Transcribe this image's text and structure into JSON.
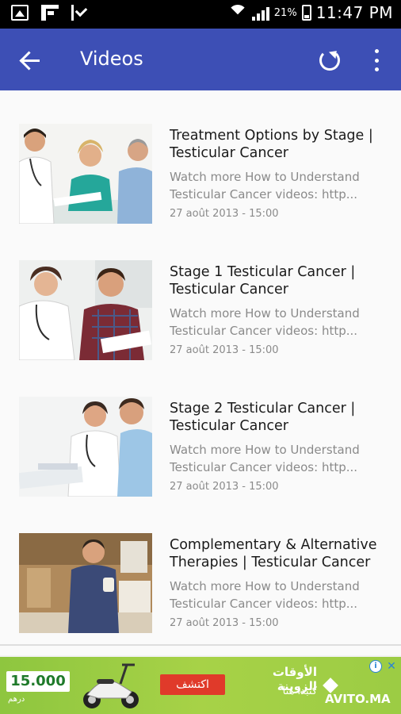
{
  "status_bar": {
    "battery_percent": "21%",
    "time": "11:47 PM",
    "left_icons": [
      "gallery-icon",
      "flipboard-icon",
      "check-icon"
    ],
    "right_icons": [
      "wifi-icon",
      "signal-icon",
      "battery-icon"
    ]
  },
  "app_bar": {
    "title": "Videos",
    "color": "#3d4fb5",
    "icons": [
      "arrow-back-icon",
      "refresh-icon",
      "more-vert-icon"
    ]
  },
  "videos": [
    {
      "title": "Treatment Options by Stage | Testicular Cancer",
      "desc_line1": "Watch more How to Understand",
      "desc_line2": "Testicular Cancer videos: http...",
      "date": "27 août 2013 - 15:00"
    },
    {
      "title": "Stage 1 Testicular Cancer | Testicular Cancer",
      "desc_line1": "Watch more How to Understand",
      "desc_line2": "Testicular Cancer videos: http...",
      "date": "27 août 2013 - 15:00"
    },
    {
      "title": "Stage 2 Testicular Cancer | Testicular Cancer",
      "desc_line1": "Watch more How to Understand",
      "desc_line2": "Testicular Cancer videos: http...",
      "date": "27 août 2013 - 15:00"
    },
    {
      "title": "Complementary & Alternative Therapies | Testicular Cancer",
      "desc_line1": "Watch more How to Understand",
      "desc_line2": "Testicular Cancer videos: http...",
      "date": "27 août 2013 - 15:00"
    }
  ],
  "ad": {
    "price": "15.000",
    "currency": "درهم",
    "cta": "اكتشف",
    "headline": "الأوقات الزوينة",
    "subline": "كتبدا هنا",
    "brand": "AVITO.MA",
    "info_label": "i",
    "close_label": "✕"
  }
}
